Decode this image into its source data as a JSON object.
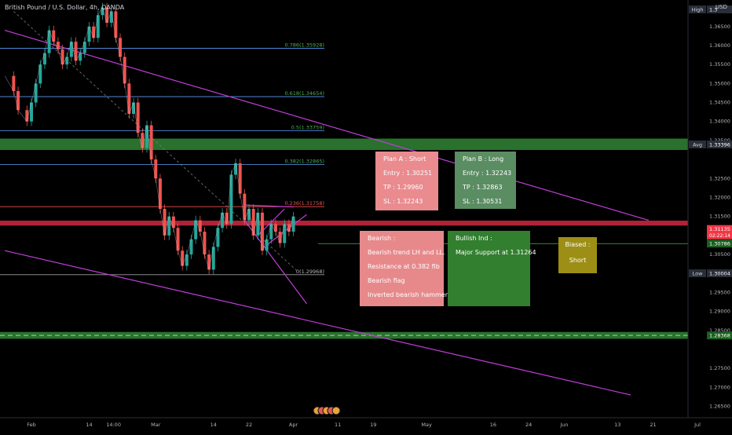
{
  "header": {
    "title": "British Pound / U.S. Dollar, 4h, OANDA",
    "currency": "USD"
  },
  "colors": {
    "background": "#000000",
    "fib_line": "#5b9cf6",
    "fib_text": "#4caf50",
    "support_green": "#2e7d32",
    "resistance_red": "#c2273b",
    "trend_purple": "#c03ed8",
    "candle_up": "#26a69a",
    "candle_down": "#ef5350",
    "price_tag_red": "#f23645",
    "price_tag_green": "#1b5e20"
  },
  "annotations": {
    "plan_a": {
      "title": "Plan A : Short",
      "entry": "Entry : 1.30251",
      "tp": "TP : 1.29960",
      "sl": "SL : 1.32243"
    },
    "plan_b": {
      "title": "Plan B : Long",
      "entry": "Entry : 1.32243",
      "tp": "TP : 1.32863",
      "sl": "SL : 1.30531"
    },
    "bearish": {
      "title": "Bearish :",
      "lines": [
        "Bearish trend LH and LL.",
        "Resistance at 0.382 fib",
        "Bearish flag",
        "Inverted bearish hammer"
      ]
    },
    "bullish": {
      "title": "Bullish Ind :",
      "lines": [
        "Major Support at 1.31264"
      ]
    },
    "biased": {
      "title": "Biased :",
      "value": "Short"
    }
  },
  "chart_data": {
    "type": "line",
    "title": "British Pound / U.S. Dollar, 4h, OANDA",
    "xlabel": "",
    "ylabel": "",
    "ylim": [
      1.262,
      1.372
    ],
    "y_ticks": [
      1.365,
      1.36,
      1.355,
      1.35,
      1.345,
      1.34,
      1.335,
      1.325,
      1.32,
      1.315,
      1.305,
      1.3,
      1.295,
      1.29,
      1.285,
      1.275,
      1.27,
      1.265
    ],
    "y_tick_labels": [
      "1.36500",
      "1.36000",
      "1.35500",
      "1.35000",
      "1.34500",
      "1.34000",
      "1.33500",
      "1.32500",
      "1.32000",
      "1.31500",
      "1.30500",
      "1.30000",
      "1.29500",
      "1.29000",
      "1.28500",
      "1.27500",
      "1.27000",
      "1.26500"
    ],
    "x_ticks": [
      {
        "label": "Feb",
        "day": 1
      },
      {
        "label": "14",
        "day": 14
      },
      {
        "label": "14:00",
        "day": 19.5
      },
      {
        "label": "Mar",
        "day": 29
      },
      {
        "label": "14",
        "day": 42
      },
      {
        "label": "22",
        "day": 50
      },
      {
        "label": "Apr",
        "day": 60
      },
      {
        "label": "11",
        "day": 70
      },
      {
        "label": "19",
        "day": 78
      },
      {
        "label": "May",
        "day": 90
      },
      {
        "label": "16",
        "day": 105
      },
      {
        "label": "24",
        "day": 113
      },
      {
        "label": "Jun",
        "day": 121
      },
      {
        "label": "13",
        "day": 133
      },
      {
        "label": "21",
        "day": 141
      },
      {
        "label": "Jul",
        "day": 151
      }
    ],
    "grid": false,
    "price_series": {
      "name": "",
      "days": [
        -5,
        -3,
        -2,
        0,
        1,
        2,
        3,
        4,
        5,
        6,
        7,
        8,
        9,
        10,
        11,
        12,
        13,
        14,
        15,
        16,
        17,
        18,
        19,
        20,
        21,
        22,
        23,
        24,
        25,
        26,
        27,
        28,
        29,
        30,
        31,
        32,
        33,
        34,
        35,
        36,
        37,
        38,
        39,
        40,
        41,
        42,
        43,
        44,
        45,
        46,
        47,
        48,
        49,
        50,
        51,
        52,
        53,
        54,
        55,
        56,
        57,
        58,
        59,
        60
      ],
      "values": [
        1.352,
        1.348,
        1.343,
        1.34,
        1.345,
        1.35,
        1.355,
        1.358,
        1.364,
        1.361,
        1.359,
        1.355,
        1.357,
        1.361,
        1.356,
        1.358,
        1.361,
        1.365,
        1.362,
        1.368,
        1.37,
        1.366,
        1.369,
        1.362,
        1.357,
        1.35,
        1.342,
        1.345,
        1.337,
        1.333,
        1.339,
        1.33,
        1.325,
        1.317,
        1.31,
        1.315,
        1.312,
        1.306,
        1.302,
        1.305,
        1.309,
        1.314,
        1.311,
        1.305,
        1.301,
        1.307,
        1.312,
        1.316,
        1.313,
        1.326,
        1.329,
        1.321,
        1.314,
        1.317,
        1.31,
        1.316,
        1.306,
        1.309,
        1.313,
        1.311,
        1.308,
        1.313,
        1.311,
        1.315
      ]
    },
    "fib_levels": [
      {
        "label": "0.786(1.35928)",
        "price": 1.35928
      },
      {
        "label": "0.618(1.34654)",
        "price": 1.34654
      },
      {
        "label": "0.5(1.33759)",
        "price": 1.33759
      },
      {
        "label": "0.382(1.32865)",
        "price": 1.32865
      },
      {
        "label": "0.236(1.31758)",
        "price": 1.31758
      },
      {
        "label": "0(1.29968)",
        "price": 1.29968
      }
    ],
    "zones": [
      {
        "name": "support",
        "low": 1.3325,
        "high": 1.3355,
        "color": "#2e7d32"
      },
      {
        "name": "resistance",
        "low": 1.3126,
        "high": 1.3139,
        "color": "#c2273b"
      },
      {
        "name": "support",
        "low": 1.2828,
        "high": 1.2846,
        "color": "#2e7d32"
      }
    ],
    "horizontal_levels": [
      {
        "price": 1.30786,
        "color": "#4caf50"
      }
    ],
    "trendlines": [
      {
        "from": [
          -5,
          1.364
        ],
        "to": [
          140,
          1.314
        ],
        "color": "#c03ed8"
      },
      {
        "from": [
          -5,
          1.306
        ],
        "to": [
          136,
          1.268
        ],
        "color": "#c03ed8"
      },
      {
        "from": [
          49,
          1.318
        ],
        "to": [
          60,
          1.3175
        ],
        "color": "#c03ed8"
      },
      {
        "from": [
          49,
          1.314
        ],
        "to": [
          63,
          1.292
        ],
        "color": "#c03ed8"
      },
      {
        "from": [
          54,
          1.3075
        ],
        "to": [
          63,
          1.3155
        ],
        "color": "#c03ed8"
      },
      {
        "from": [
          52,
          1.31
        ],
        "to": [
          58,
          1.317
        ],
        "color": "#c03ed8"
      }
    ],
    "price_tags": [
      {
        "label": "High",
        "value": "1.3",
        "price": 1.3695,
        "color": "#2a2e39"
      },
      {
        "label": "Avg",
        "value": "1.33396",
        "price": 1.33396,
        "color": "#2a2e39"
      },
      {
        "label": "",
        "value": "1.31135",
        "sub": "02:22:14",
        "price": 1.3117,
        "color": "#f23645"
      },
      {
        "label": "",
        "value": "1.30786",
        "price": 1.30786,
        "color": "#1b5e20"
      },
      {
        "label": "Low",
        "value": "1.30004",
        "price": 1.30004,
        "color": "#2a2e39"
      },
      {
        "label": "",
        "value": "1.28368",
        "price": 1.28368,
        "color": "#1b5e20"
      }
    ]
  }
}
